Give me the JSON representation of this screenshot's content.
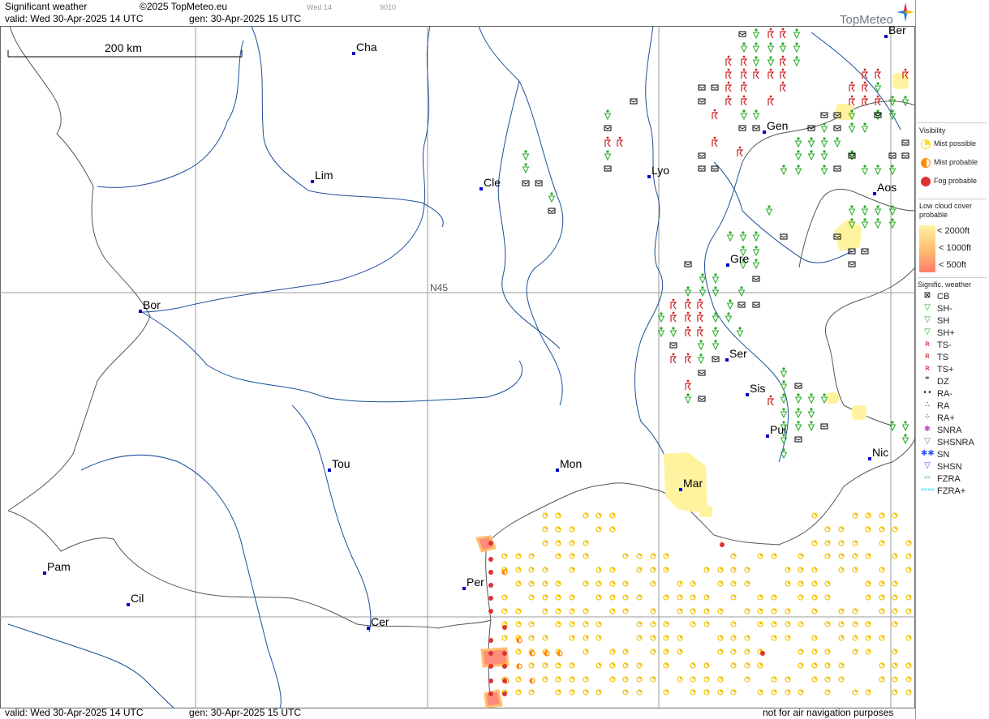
{
  "header": {
    "title": "Significant weather",
    "copyright": "©2025 TopMeteo.eu",
    "run_label": "Wed 14",
    "code": "9010",
    "valid": "valid:  Wed  30-Apr-2025  14 UTC",
    "gen": "gen:  30-Apr-2025  15 UTC",
    "logo": "TopMeteo"
  },
  "scale_label": "200 km",
  "grid_label": "N45",
  "cities": [
    {
      "name": "Cha"
    },
    {
      "name": "Ber"
    },
    {
      "name": "Lim"
    },
    {
      "name": "Cle"
    },
    {
      "name": "Lyo"
    },
    {
      "name": "Gen"
    },
    {
      "name": "Aos"
    },
    {
      "name": "Gre"
    },
    {
      "name": "Bor"
    },
    {
      "name": "Ser"
    },
    {
      "name": "Sis"
    },
    {
      "name": "Pui"
    },
    {
      "name": "Tou"
    },
    {
      "name": "Mon"
    },
    {
      "name": "Mar"
    },
    {
      "name": "Nic"
    },
    {
      "name": "Pam"
    },
    {
      "name": "Cil"
    },
    {
      "name": "Per"
    },
    {
      "name": "Cer"
    }
  ],
  "legend": {
    "visibility_title": "Visibility",
    "visibility": [
      {
        "label": "Mist possible",
        "color": "#ffdd22"
      },
      {
        "label": "Mist probable",
        "color": "#ff8800"
      },
      {
        "label": "Fog probable",
        "color": "#dd3333"
      }
    ],
    "lowcloud_title": "Low cloud cover probable",
    "lowcloud": [
      {
        "label": "< 2000ft",
        "color": "#fff3a0"
      },
      {
        "label": "< 1000ft",
        "color": "#ffc070"
      },
      {
        "label": "<   500ft",
        "color": "#ff7b6b"
      }
    ],
    "sigwx_title": "Signific. weather",
    "sigwx": [
      {
        "code": "CB",
        "icon": "cb-icon",
        "color": "#000000"
      },
      {
        "code": "SH-",
        "icon": "shower-light-icon",
        "color": "#22aa22"
      },
      {
        "code": "SH",
        "icon": "shower-icon",
        "color": "#22aa22"
      },
      {
        "code": "SH+",
        "icon": "shower-heavy-icon",
        "color": "#22aa22"
      },
      {
        "code": "TS-",
        "icon": "thunderstorm-light-icon",
        "color": "#cc2222"
      },
      {
        "code": "TS",
        "icon": "thunderstorm-icon",
        "color": "#cc2222"
      },
      {
        "code": "TS+",
        "icon": "thunderstorm-heavy-icon",
        "color": "#cc2222"
      },
      {
        "code": "DZ",
        "icon": "drizzle-icon",
        "color": "#115511"
      },
      {
        "code": "RA-",
        "icon": "rain-light-icon",
        "color": "#115511"
      },
      {
        "code": "RA",
        "icon": "rain-icon",
        "color": "#115511"
      },
      {
        "code": "RA+",
        "icon": "rain-heavy-icon",
        "color": "#115511"
      },
      {
        "code": "SNRA",
        "icon": "sleet-icon",
        "color": "#cc44cc"
      },
      {
        "code": "SHSNRA",
        "icon": "sleet-shower-icon",
        "color": "#cc44cc"
      },
      {
        "code": "SN",
        "icon": "snow-icon",
        "color": "#3355ff"
      },
      {
        "code": "SHSN",
        "icon": "snow-shower-icon",
        "color": "#3355ff"
      },
      {
        "code": "FZRA",
        "icon": "freezing-rain-icon",
        "color": "#33ccdd"
      },
      {
        "code": "FZRA+",
        "icon": "freezing-rain-heavy-icon",
        "color": "#33ccdd"
      }
    ]
  },
  "footer": {
    "valid": "valid:  Wed  30-Apr-2025  14 UTC",
    "gen": "gen:  30-Apr-2025  15 UTC",
    "disclaimer": "not for air navigation purposes"
  }
}
